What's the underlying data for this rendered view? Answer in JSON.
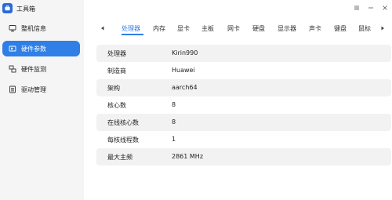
{
  "app": {
    "title": "工具箱",
    "accent": "#2f7fe6"
  },
  "sidebar": {
    "items": [
      {
        "label": "整机信息",
        "icon": "computer-icon"
      },
      {
        "label": "硬件参数",
        "icon": "hardware-icon",
        "active": true
      },
      {
        "label": "硬件监测",
        "icon": "monitor-icon"
      },
      {
        "label": "驱动管理",
        "icon": "driver-icon"
      }
    ]
  },
  "window": {
    "menu_icon": "menu-icon",
    "minimize_icon": "minimize-icon",
    "close_icon": "close-icon"
  },
  "tabs": {
    "items": [
      "处理器",
      "内存",
      "显卡",
      "主板",
      "网卡",
      "硬盘",
      "显示器",
      "声卡",
      "键盘",
      "鼠标"
    ],
    "active": 0
  },
  "details": {
    "rows": [
      {
        "key": "处理器",
        "value": "Kirin990"
      },
      {
        "key": "制造商",
        "value": "Huawei"
      },
      {
        "key": "架构",
        "value": "aarch64"
      },
      {
        "key": "核心数",
        "value": "8"
      },
      {
        "key": "在线核心数",
        "value": "8"
      },
      {
        "key": "每核线程数",
        "value": "1"
      },
      {
        "key": "最大主频",
        "value": "2861 MHz"
      }
    ]
  }
}
